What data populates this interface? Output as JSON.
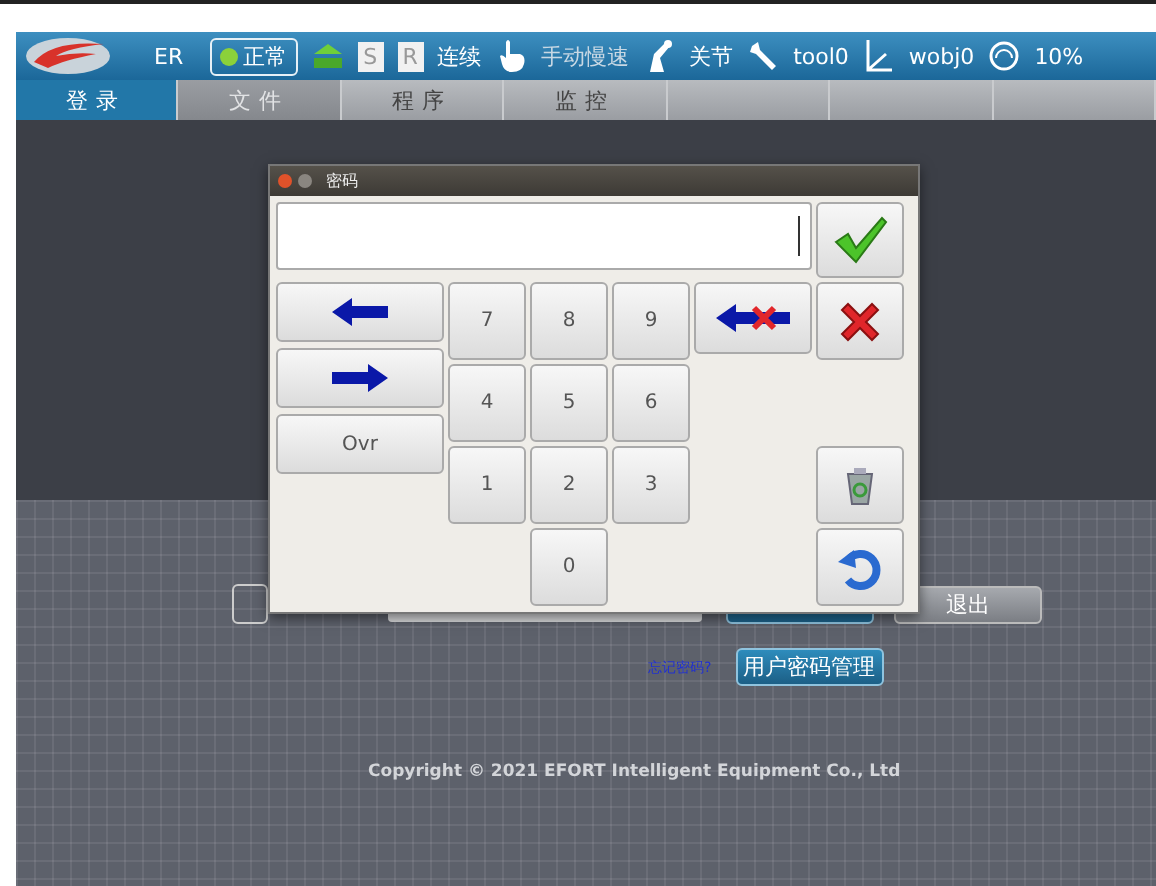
{
  "header": {
    "robot": "ER",
    "status": "正常",
    "s_key": "S",
    "r_key": "R",
    "run_mode": "连续",
    "speed_mode": "手动慢速",
    "motion": "关节",
    "tool": "tool0",
    "wobj": "wobj0",
    "speed": "10%"
  },
  "tabs": [
    {
      "label": "登录",
      "selected": true,
      "disabled": false
    },
    {
      "label": "文件",
      "selected": false,
      "disabled": true
    },
    {
      "label": "程序",
      "selected": false,
      "disabled": false
    },
    {
      "label": "监控",
      "selected": false,
      "disabled": false
    }
  ],
  "dialog": {
    "title": "密码",
    "keypad": [
      "7",
      "8",
      "9",
      "4",
      "5",
      "6",
      "1",
      "2",
      "3",
      "0"
    ],
    "ovr_key": "Ovr"
  },
  "login": {
    "forgot_link": "忘记密码?",
    "exit_button": "退出",
    "user_manage_button": "用户密码管理"
  },
  "copyright": "Copyright © 2021 EFORT Intelligent Equipment Co., Ltd"
}
